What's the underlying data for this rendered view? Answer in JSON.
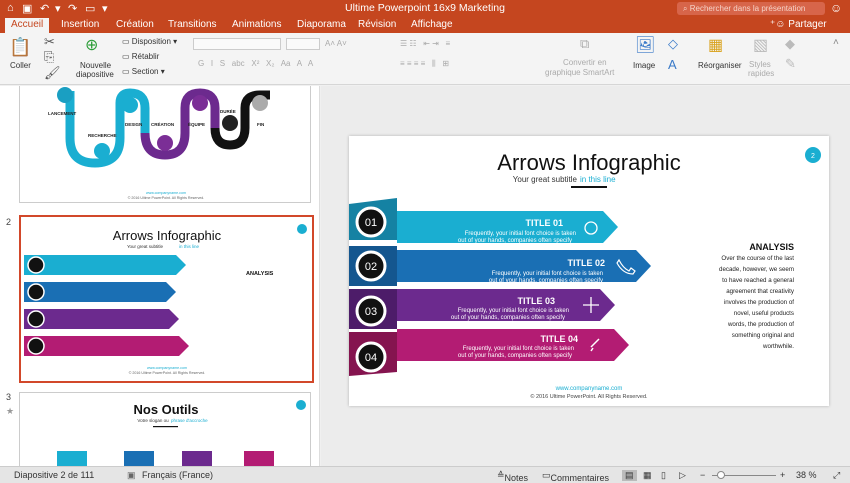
{
  "window": {
    "title": "Ultime Powerpoint 16x9 Marketing",
    "search_placeholder": "Rechercher dans la présentation"
  },
  "tabs": [
    {
      "label": "Accueil",
      "active": true
    },
    {
      "label": "Insertion"
    },
    {
      "label": "Création"
    },
    {
      "label": "Transitions"
    },
    {
      "label": "Animations"
    },
    {
      "label": "Diaporama"
    },
    {
      "label": "Révision"
    },
    {
      "label": "Affichage"
    }
  ],
  "share_label": "Partager",
  "ribbon": {
    "paste": "Coller",
    "new_slide": "Nouvelle",
    "new_slide2": "diapositive",
    "layout": "Disposition",
    "reset": "Rétablir",
    "section": "Section",
    "smartart": "Convertir en",
    "smartart2": "graphique SmartArt",
    "image": "Image",
    "arrange": "Réorganiser",
    "styles": "Styles",
    "styles2": "rapides"
  },
  "thumbs": [
    {
      "number": "",
      "labels": [
        "LANCEMENT",
        "RECHERCHE",
        "DESIGN",
        "CRÉATION",
        "ÉQUIPE",
        "DURÉE",
        "FIN"
      ],
      "footer_url": "www.companyname.com",
      "footer": "© 2016 Ultime PowerPoint. All Rights Reserved."
    },
    {
      "number": "2",
      "title": "Arrows Infographic",
      "subtitle": "Your great subtitle",
      "subtitle_em": "in this line"
    },
    {
      "number": "3",
      "title": "Nos Outils",
      "subtitle": "Votre slogan ou",
      "subtitle_em": "phrase d'accroche"
    }
  ],
  "slide": {
    "title": "Arrows Infographic",
    "subtitle": "Your great subtitle",
    "subtitle_em": "in this line",
    "page": "2",
    "rows": [
      {
        "num": "01",
        "title": "TITLE 01",
        "text1": "Frequently, your initial font choice is taken",
        "text2": "out of your hands, companies often specify"
      },
      {
        "num": "02",
        "title": "TITLE 02",
        "text1": "Frequently, your initial font choice is taken",
        "text2": "out of your hands, companies often specify"
      },
      {
        "num": "03",
        "title": "TITLE 03",
        "text1": "Frequently, your initial font choice is taken",
        "text2": "out of your hands, companies often specify"
      },
      {
        "num": "04",
        "title": "TITLE 04",
        "text1": "Frequently, your initial font choice is taken",
        "text2": "out of your hands, companies often specify"
      }
    ],
    "analysis_title": "ANALYSIS",
    "analysis_lines": [
      "Over the course of the last",
      "decade, however, we seem",
      "to have reached a general",
      "agreement that creativity",
      "involves the production of",
      "novel, useful products",
      "words, the production of",
      "something original and",
      "worthwhile."
    ],
    "footer_url": "www.companyname.com",
    "footer": "© 2016 Ultime PowerPoint. All Rights Reserved."
  },
  "status": {
    "slide": "Diapositive 2 de 111",
    "lang": "Français (France)",
    "notes": "Notes",
    "comments": "Commentaires",
    "zoom": "38 %"
  }
}
